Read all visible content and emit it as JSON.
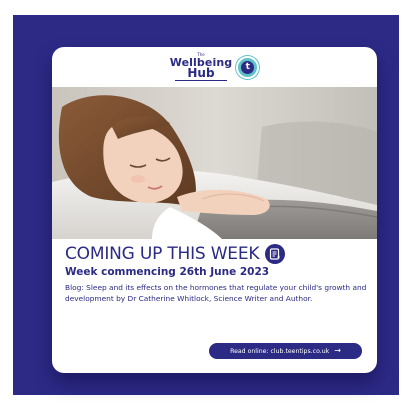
{
  "logo": {
    "small_text": "The",
    "line1": "Wellbeing",
    "line2": "Hub",
    "badge_glyph": "t",
    "badge_color": "#5ec2c7",
    "brand_color": "#2b2a84"
  },
  "photo": {
    "icon": "sleeping-child-photo"
  },
  "headline": {
    "title": "COMING UP THIS WEEK",
    "icon": "document-icon"
  },
  "subheading": "Week commencing 26th June 2023",
  "blog_text": "Blog: Sleep and its effects on the hormones that regulate your child's growth and development by Dr Catherine Whitlock, Science Writer and Author.",
  "cta": {
    "label": "Read online: club.teentips.co.uk",
    "icon": "arrow-right-icon"
  },
  "colors": {
    "background_frame": "#2d2a86",
    "card": "#ffffff",
    "accent": "#5ec2c7"
  }
}
